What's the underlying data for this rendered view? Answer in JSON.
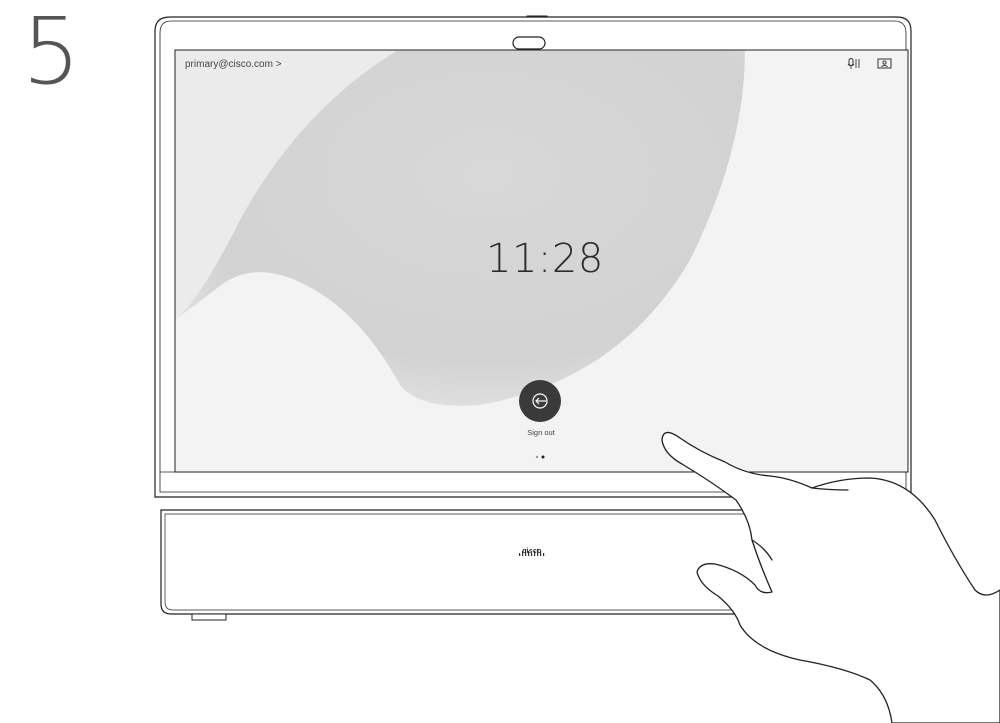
{
  "step": "5",
  "screen": {
    "account_label": "primary@cisco.com >",
    "clock": "11:28",
    "sign_out_label": "Sign out",
    "page_indicator": {
      "pages": 2,
      "active": 2
    }
  },
  "device": {
    "brand": "cisco"
  },
  "icons": [
    "mic-icon",
    "screen-icon",
    "sign-out-icon",
    "camera-icon",
    "cisco-logo-icon",
    "hand-pointer-icon"
  ],
  "colors": {
    "outline": "#222222",
    "screen_background": "#f2f2f2",
    "wallpaper_shape": "#d6d6d6",
    "button": "#3a3a3a"
  }
}
